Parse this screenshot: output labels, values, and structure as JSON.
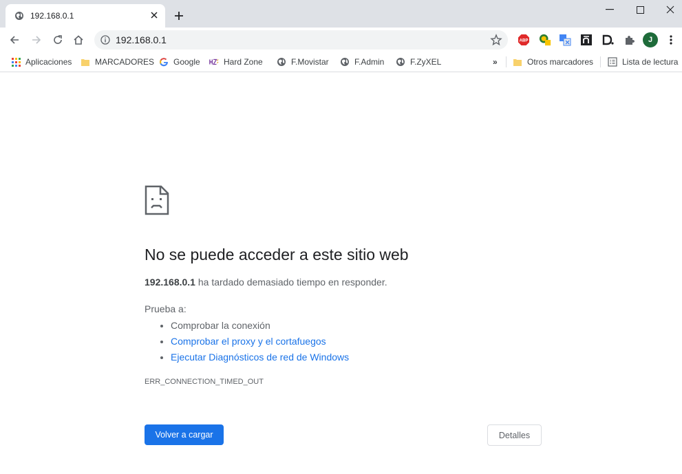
{
  "tab": {
    "title": "192.168.0.1"
  },
  "omnibox": {
    "url": "192.168.0.1"
  },
  "bookmarks": [
    {
      "label": "Aplicaciones",
      "icon": "apps-grid-icon"
    },
    {
      "label": "MARCADORES",
      "icon": "folder-icon"
    },
    {
      "label": "Google",
      "icon": "google-g-icon"
    },
    {
      "label": "Hard Zone",
      "icon": "hardzone-icon"
    },
    {
      "label": "F.Movistar",
      "icon": "globe-icon"
    },
    {
      "label": "F.Admin",
      "icon": "globe-icon"
    },
    {
      "label": "F.ZyXEL",
      "icon": "globe-icon"
    }
  ],
  "bookmarks_overflow": "»",
  "other_bookmarks": "Otros marcadores",
  "reading_list": "Lista de lectura",
  "extensions": {
    "abp": "ABP",
    "profile_initial": "J"
  },
  "error": {
    "heading": "No se puede acceder a este sitio web",
    "host": "192.168.0.1",
    "message": " ha tardado demasiado tiempo en responder.",
    "try_label": "Prueba a:",
    "suggestion_1": "Comprobar la conexión",
    "suggestion_2": "Comprobar el proxy y el cortafuegos",
    "suggestion_3": "Ejecutar Diagnósticos de red de Windows",
    "code": "ERR_CONNECTION_TIMED_OUT",
    "reload_label": "Volver a cargar",
    "details_label": "Detalles"
  },
  "colors": {
    "accent": "#1a73e8",
    "titlebar": "#dee1e6",
    "omnibox": "#f1f3f4"
  }
}
